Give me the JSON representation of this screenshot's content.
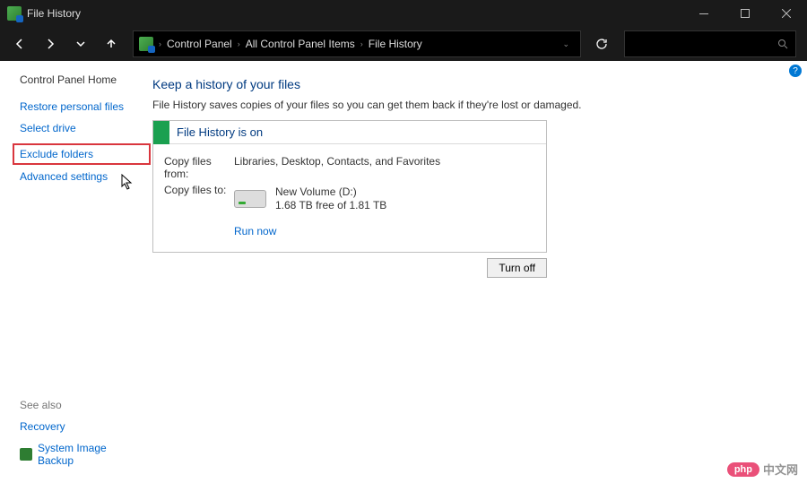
{
  "titlebar": {
    "title": "File History"
  },
  "nav": {
    "crumbs": [
      "Control Panel",
      "All Control Panel Items",
      "File History"
    ]
  },
  "sidebar": {
    "home": "Control Panel Home",
    "links": {
      "restore": "Restore personal files",
      "select_drive": "Select drive",
      "exclude": "Exclude folders",
      "advanced": "Advanced settings"
    },
    "see_also_heading": "See also",
    "see_also": {
      "recovery": "Recovery",
      "sib": "System Image Backup"
    }
  },
  "main": {
    "heading": "Keep a history of your files",
    "description": "File History saves copies of your files so you can get them back if they're lost or damaged.",
    "status_text": "File History is on",
    "copy_from_label": "Copy files from:",
    "copy_from_value": "Libraries, Desktop, Contacts, and Favorites",
    "copy_to_label": "Copy files to:",
    "drive_name": "New Volume (D:)",
    "drive_space": "1.68 TB free of 1.81 TB",
    "run_now": "Run now",
    "turn_off": "Turn off"
  },
  "watermark": {
    "brand": "php",
    "text": "中文网"
  },
  "help_badge": "?"
}
